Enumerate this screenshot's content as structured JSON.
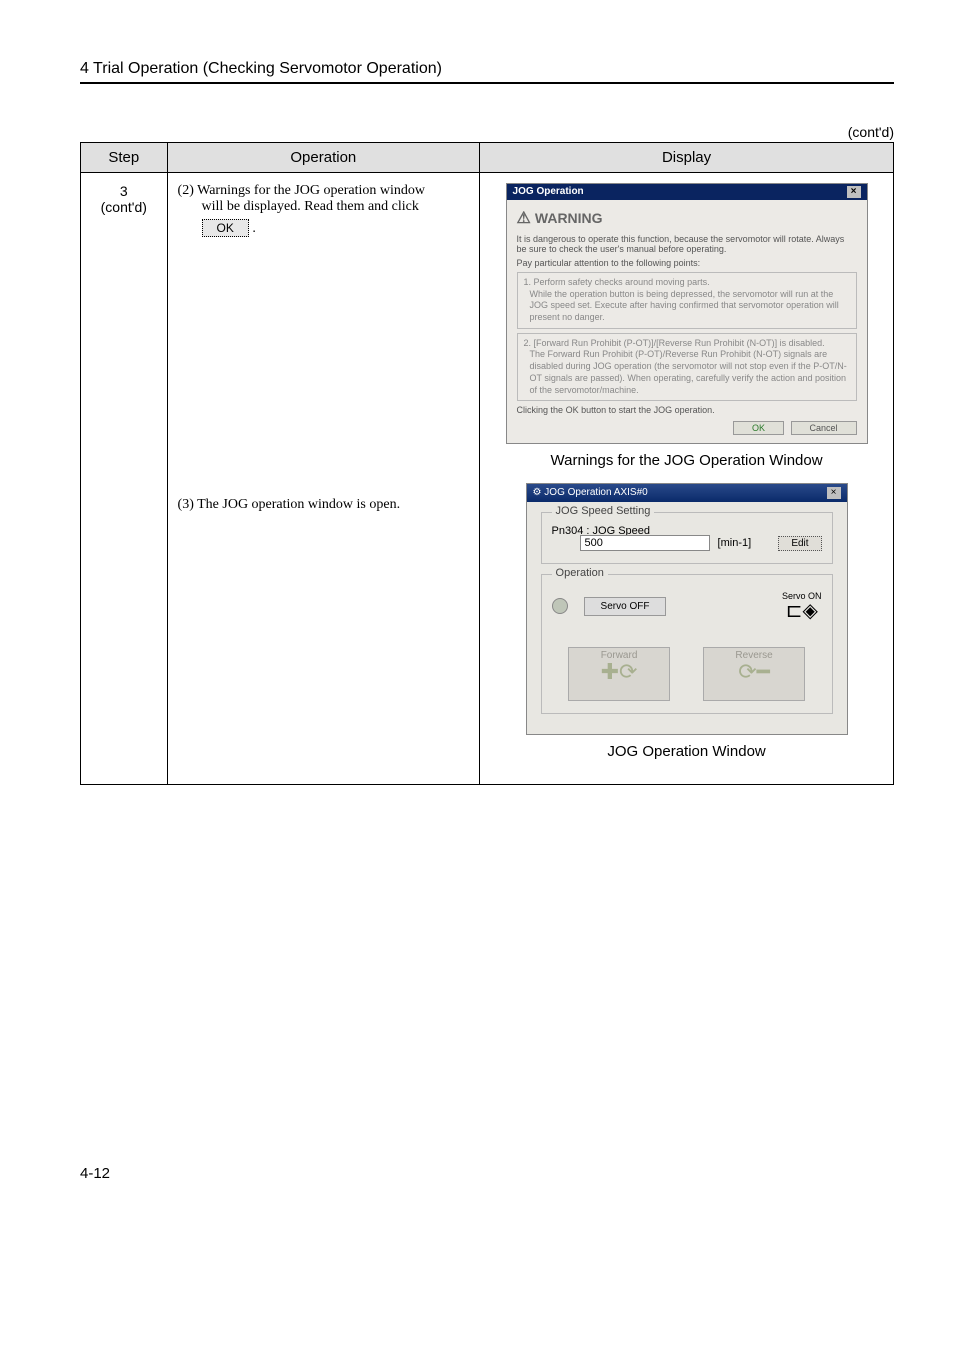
{
  "chapterTitle": "4  Trial Operation (Checking Servomotor Operation)",
  "contd": "(cont'd)",
  "headers": {
    "step": "Step",
    "operation": "Operation",
    "display": "Display"
  },
  "row": {
    "stepNum": "3",
    "stepContd": "(cont'd)",
    "op1_line1": "(2) Warnings for the JOG operation window",
    "op1_line2": "will be displayed. Read them and click",
    "okLabel": "OK",
    "op1_period": ".",
    "op2": "(3) The JOG operation window is open."
  },
  "dlg1": {
    "title": "JOG Operation",
    "warning": "WARNING",
    "p1": "It is dangerous to operate this function, because the servomotor will rotate. Always be sure to check the user's manual before operating.",
    "p2": "Pay particular attention to the following points:",
    "box1_h": "1. Perform safety checks around moving parts.",
    "box1_t": "While the operation button is being depressed, the servomotor will run at the JOG speed set. Execute after having confirmed that servomotor operation will present no danger.",
    "box2_h": "2. [Forward Run Prohibit (P-OT)]/[Reverse Run Prohibit (N-OT)] is disabled.",
    "box2_t": "The Forward Run Prohibit (P-OT)/Reverse Run Prohibit (N-OT) signals are disabled during JOG operation (the servomotor will not stop even if the P-OT/N-OT signals are passed). When operating, carefully verify the action and position of the servomotor/machine.",
    "p3": "Clicking the OK button to start the JOG operation.",
    "ok": "OK",
    "cancel": "Cancel",
    "caption": "Warnings for the JOG Operation Window"
  },
  "dlg2": {
    "title": "JOG Operation AXIS#0",
    "legend1": "JOG Speed Setting",
    "param": "Pn304 : JOG Speed",
    "value": "500",
    "unit": "[min-1]",
    "edit": "Edit",
    "legend2": "Operation",
    "servoOff": "Servo OFF",
    "servoOn": "Servo ON",
    "forward": "Forward",
    "reverse": "Reverse",
    "caption": "JOG Operation Window"
  },
  "pageNum": "4-12"
}
